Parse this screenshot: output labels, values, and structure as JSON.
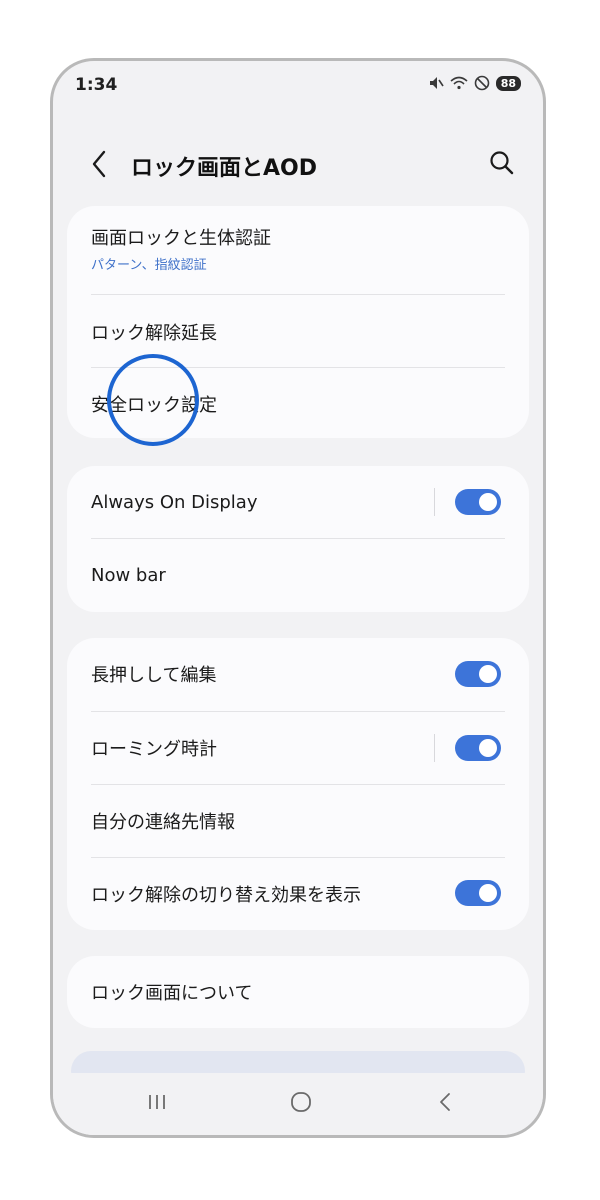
{
  "status_bar": {
    "time": "1:34",
    "battery": "88",
    "icons": [
      "mute-icon",
      "wifi-icon",
      "dnd-icon",
      "battery-icon"
    ]
  },
  "header": {
    "title": "ロック画面とAOD",
    "back_icon": "chevron-left-icon",
    "search_icon": "search-icon"
  },
  "group1": {
    "item1_label": "画面ロックと生体認証",
    "item1_sub": "パターン、指紋認証",
    "item2_label": "ロック解除延長",
    "item3_label": "安全ロック設定"
  },
  "group2": {
    "item1_label": "Always On Display",
    "item1_toggle": true,
    "item2_label": "Now bar"
  },
  "group3": {
    "item1_label": "長押しして編集",
    "item1_toggle": true,
    "item2_label": "ローミング時計",
    "item2_toggle": true,
    "item3_label": "自分の連絡先情報",
    "item4_label": "ロック解除の切り替え効果を表示",
    "item4_toggle": true
  },
  "group4": {
    "item1_label": "ロック画面について"
  },
  "navbar": {
    "icons": [
      "recent-apps-icon",
      "home-icon",
      "back-icon"
    ]
  },
  "colors": {
    "accent": "#3d74d9",
    "highlight": "#1d65d1",
    "background": "#f2f2f4",
    "card": "#fbfbfd"
  }
}
